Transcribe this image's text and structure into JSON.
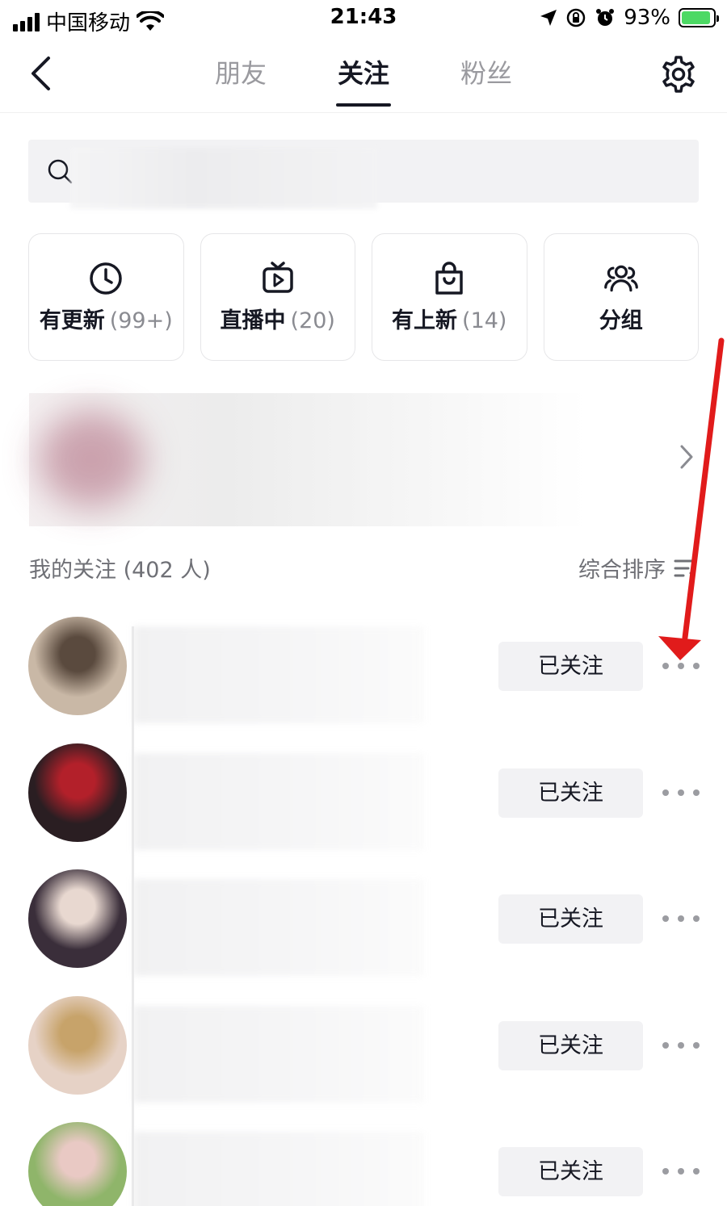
{
  "status_bar": {
    "carrier": "中国移动",
    "time": "21:43",
    "battery": "93%",
    "battery_level": 0.93
  },
  "nav": {
    "back_icon": "chevron-left-icon",
    "tabs": [
      {
        "label": "朋友",
        "active": false
      },
      {
        "label": "关注",
        "active": true
      },
      {
        "label": "粉丝",
        "active": false
      }
    ],
    "settings_icon": "gear-icon"
  },
  "search": {
    "icon": "search-icon",
    "placeholder": ""
  },
  "quick_cards": [
    {
      "label": "有更新",
      "count": "(99+)",
      "icon": "clock-icon"
    },
    {
      "label": "直播中",
      "count": "(20)",
      "icon": "live-tv-icon"
    },
    {
      "label": "有上新",
      "count": "(14)",
      "icon": "shopping-bag-icon"
    },
    {
      "label": "分组",
      "count": "",
      "icon": "group-icon"
    }
  ],
  "section": {
    "title": "我的关注 (402 人)",
    "sort_label": "综合排序",
    "sort_icon": "sort-icon"
  },
  "follow_list": {
    "button_label": "已关注",
    "more_icon": "more-dots-icon",
    "rows": [
      {
        "avatar_colors": [
          "#c9b8a6",
          "#5a4a3e"
        ]
      },
      {
        "avatar_colors": [
          "#2a1e22",
          "#b3202a"
        ]
      },
      {
        "avatar_colors": [
          "#3a2e3a",
          "#e8d8d0"
        ]
      },
      {
        "avatar_colors": [
          "#e6d2c6",
          "#c7a36a"
        ]
      },
      {
        "avatar_colors": [
          "#8fb56a",
          "#e9c9c4"
        ]
      }
    ]
  },
  "colors": {
    "accent_text": "#161823",
    "muted_text": "#8a8b91",
    "button_bg": "#f2f2f4",
    "annotation_arrow": "#e11b1b"
  }
}
